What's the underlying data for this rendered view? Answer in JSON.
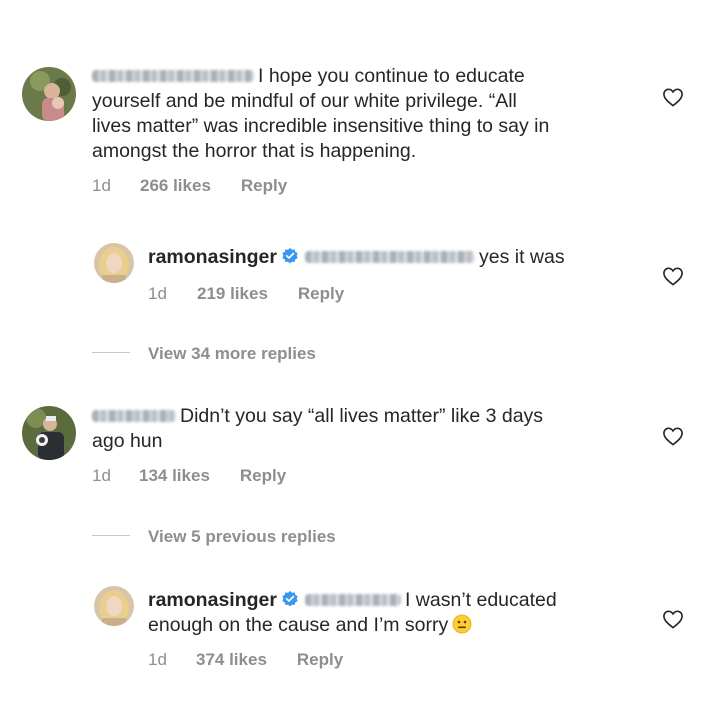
{
  "comments": [
    {
      "text_lines": [
        "I hope you continue to educate",
        "yourself and be mindful of our white privilege. “All",
        "lives matter” was incredible insensitive thing to say in",
        "amongst the horror that is happening."
      ],
      "time": "1d",
      "likes": "266 likes",
      "reply": "Reply",
      "icon": "heart-outline-icon"
    },
    {
      "username": "ramonasinger",
      "text_lines": [
        "yes it was"
      ],
      "time": "1d",
      "likes": "219 likes",
      "reply": "Reply",
      "icon": "heart-outline-icon"
    },
    {
      "text_lines": [
        "Didn’t you say “all lives matter” like 3 days",
        "ago hun"
      ],
      "time": "1d",
      "likes": "134 likes",
      "reply": "Reply",
      "icon": "heart-outline-icon"
    },
    {
      "username": "ramonasinger",
      "text_lines": [
        "I wasn’t educated",
        "enough on the cause and I’m  sorry"
      ],
      "time": "1d",
      "likes": "374 likes",
      "reply": "Reply",
      "icon": "heart-outline-icon"
    }
  ],
  "view_more_replies": "View 34 more replies",
  "view_previous_replies": "View 5 previous replies",
  "colors": {
    "text": "#262626",
    "meta": "#8e8e8e",
    "verified": "#3897f0",
    "divider": "#c7c7c7"
  }
}
